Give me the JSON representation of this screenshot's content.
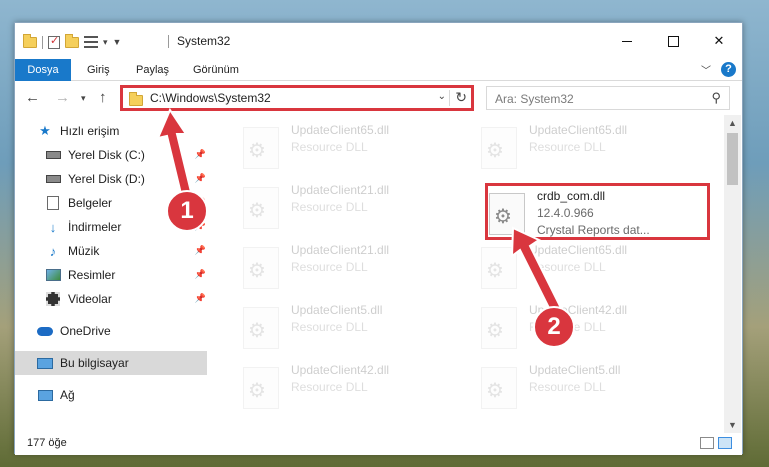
{
  "window": {
    "title": "System32",
    "controls": {
      "minimize": "",
      "maximize": "",
      "close": "✕"
    }
  },
  "ribbon": {
    "tabs": [
      "Dosya",
      "Giriş",
      "Paylaş",
      "Görünüm"
    ]
  },
  "address_bar": {
    "path": "C:\\Windows\\System32",
    "search_placeholder": "Ara: System32"
  },
  "sidebar": {
    "items": [
      {
        "label": "Hızlı erişim",
        "icon": "star-icon"
      },
      {
        "label": "Yerel Disk (C:)",
        "icon": "drive-icon",
        "pinned": true
      },
      {
        "label": "Yerel Disk (D:)",
        "icon": "drive-icon",
        "pinned": true
      },
      {
        "label": "Belgeler",
        "icon": "documents-icon",
        "pinned": true
      },
      {
        "label": "İndirmeler",
        "icon": "download-icon",
        "pinned": true
      },
      {
        "label": "Müzik",
        "icon": "music-icon",
        "pinned": true
      },
      {
        "label": "Resimler",
        "icon": "pictures-icon",
        "pinned": true
      },
      {
        "label": "Videolar",
        "icon": "videos-icon",
        "pinned": true
      },
      {
        "label": "OneDrive",
        "icon": "cloud-icon"
      },
      {
        "label": "Bu bilgisayar",
        "icon": "computer-icon",
        "selected": true
      },
      {
        "label": "Ağ",
        "icon": "network-icon"
      }
    ]
  },
  "files": {
    "left_column": [
      {
        "name": "UpdateClient65.dll",
        "type": "Resource DLL"
      },
      {
        "name": "UpdateClient21.dll",
        "type": "Resource DLL"
      },
      {
        "name": "UpdateClient21.dll",
        "type": "Resource DLL"
      },
      {
        "name": "UpdateClient5.dll",
        "type": "Resource DLL"
      },
      {
        "name": "UpdateClient42.dll",
        "type": "Resource DLL"
      }
    ],
    "right_column": [
      {
        "name": "UpdateClient65.dll",
        "type": "Resource DLL"
      },
      {
        "name": "crdb_com.dll",
        "version": "12.4.0.966",
        "type": "Crystal Reports dat..."
      },
      {
        "name": "UpdateClient65.dll",
        "type": "Resource DLL"
      },
      {
        "name": "UpdateClient42.dll",
        "type": "Resource DLL"
      },
      {
        "name": "UpdateClient5.dll",
        "type": "Resource DLL"
      }
    ]
  },
  "status_bar": {
    "item_count": "177 öğe"
  },
  "annotations": {
    "badge_1": "1",
    "badge_2": "2",
    "color": "#d9363e"
  }
}
